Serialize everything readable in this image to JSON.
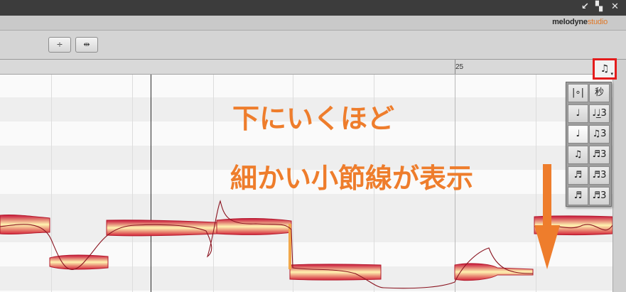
{
  "app": {
    "logo_main": "melodyne",
    "logo_sub": "studio"
  },
  "window_controls": {
    "restore_icon": "↙",
    "maximize_icon": "▚",
    "close_icon": "✕"
  },
  "toolbar": {
    "tool1_icon": "÷",
    "tool2_icon": "⇹"
  },
  "ruler": {
    "bar_label": "25"
  },
  "grid_button": {
    "icon": "♫",
    "caret": "▾"
  },
  "grid_menu": {
    "items": [
      {
        "label": "|∘|",
        "selected": false
      },
      {
        "label": "秒",
        "selected": false
      },
      {
        "label": "♩",
        "selected": false
      },
      {
        "label": "♩♩̲3",
        "selected": false
      },
      {
        "label": "♩",
        "selected": true
      },
      {
        "label": "♫3",
        "selected": false
      },
      {
        "label": "♫",
        "selected": false
      },
      {
        "label": "♬3",
        "selected": false
      },
      {
        "label": "♬",
        "selected": false
      },
      {
        "label": "♬3",
        "selected": false
      },
      {
        "label": "♬",
        "selected": false
      },
      {
        "label": "♬3",
        "selected": false
      }
    ]
  },
  "annotation": {
    "line1": "下にいくほど",
    "line2": "細かい小節線が表示"
  },
  "colors": {
    "accent": "#ee7d2c",
    "highlight": "#e41c1c",
    "blob_fill_dark": "#c8143a",
    "blob_fill_light": "#fff3b0"
  }
}
